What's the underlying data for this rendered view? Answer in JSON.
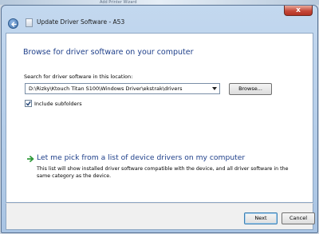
{
  "desktop": {
    "caption": "Add Printer Wizard"
  },
  "window": {
    "title": "Update Driver Software - A53",
    "close_glyph": "x"
  },
  "main": {
    "heading": "Browse for driver software on your computer",
    "search_label": "Search for driver software in this location:",
    "path_value": "D:\\Rizky\\Ktouch Titan S100\\Windows Driver\\ekstrak\\drivers",
    "browse_label": "Browse...",
    "include_subfolders_label": "Include subfolders",
    "include_subfolders_checked": true,
    "pick_link": "Let me pick from a list of device drivers on my computer",
    "pick_description": "This list will show installed driver software compatible with the device, and all driver software in the same category as the device."
  },
  "footer": {
    "next_label": "Next",
    "cancel_label": "Cancel"
  },
  "colors": {
    "heading_blue": "#1e3f8a",
    "link_arrow_green": "#2f9a3a",
    "close_red": "#c6493a"
  },
  "icons": {
    "back": "back-arrow-icon",
    "title": "driver-window-icon",
    "link_arrow": "green-arrow-icon",
    "combo": "chevron-down-icon",
    "check": "checkmark-icon"
  }
}
